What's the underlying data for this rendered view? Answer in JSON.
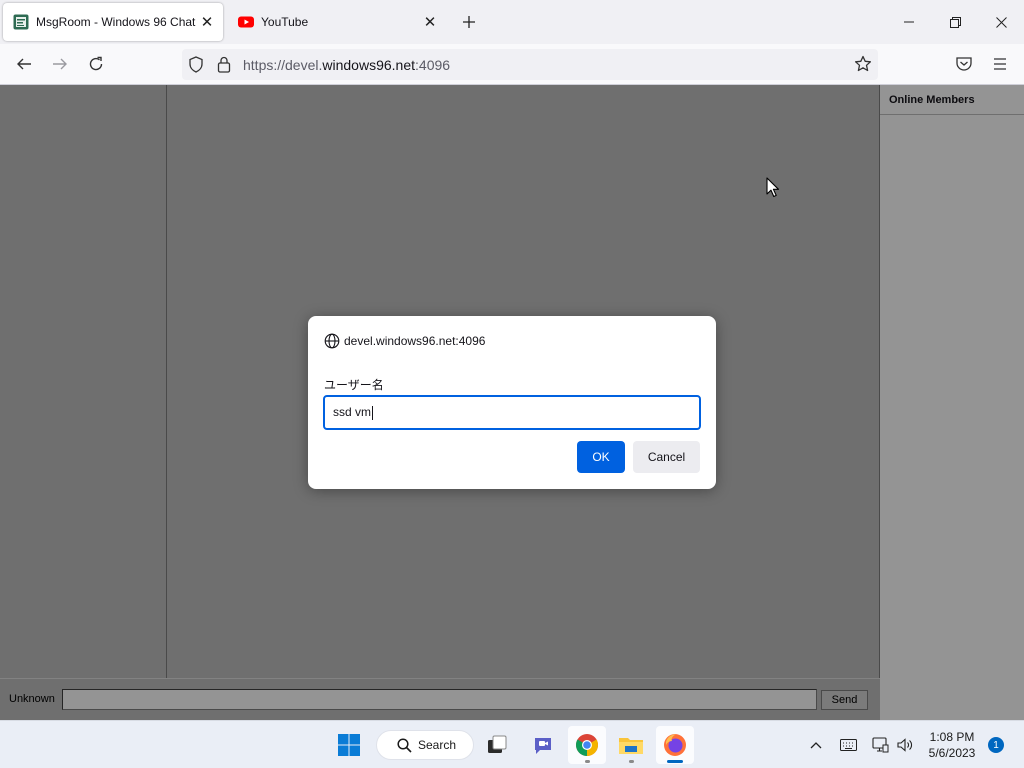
{
  "browser": {
    "tabs": [
      {
        "title": "MsgRoom - Windows 96 Chat",
        "active": true,
        "favicon": "msgroom-favicon"
      },
      {
        "title": "YouTube",
        "active": false,
        "favicon": "youtube-favicon"
      }
    ],
    "url": {
      "prefix": "https://devel.",
      "host": "windows96.net",
      "suffix": ":4096"
    }
  },
  "chat": {
    "members_header": "Online Members",
    "nickname": "Unknown",
    "message_value": "",
    "send_label": "Send"
  },
  "dialog": {
    "origin": "devel.windows96.net:4096",
    "label": "ユーザー名",
    "input_value": "ssd vm",
    "ok_label": "OK",
    "cancel_label": "Cancel"
  },
  "taskbar": {
    "search_label": "Search",
    "time": "1:08 PM",
    "date": "5/6/2023",
    "notification_count": "1"
  },
  "colors": {
    "accent": "#0061e0",
    "youtube_red": "#ff0000",
    "page_bg": "#c0c0c0",
    "windows_blue": "#0067c0"
  }
}
